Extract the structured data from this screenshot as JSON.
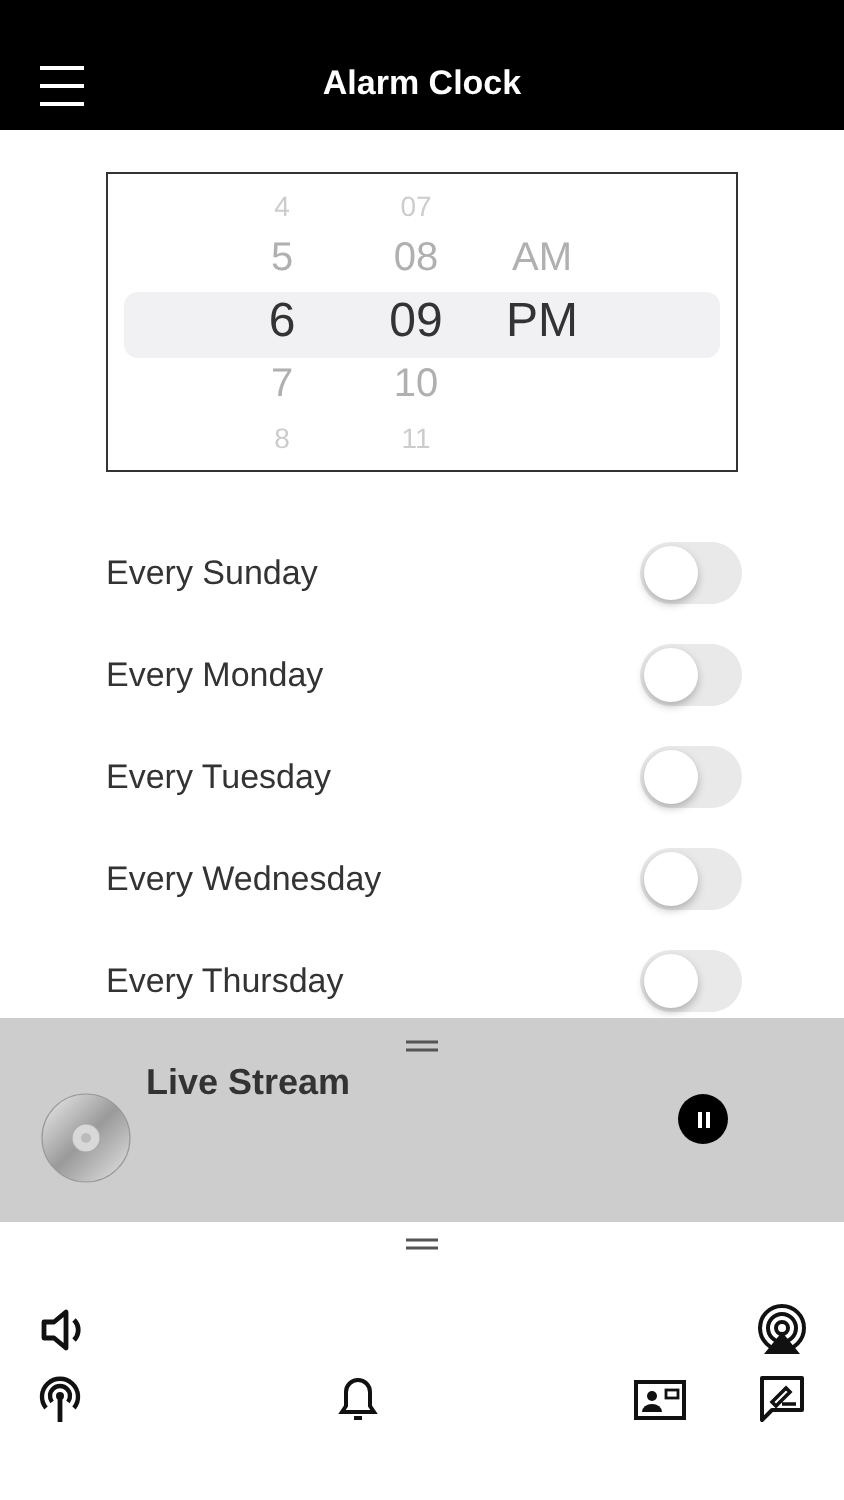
{
  "header": {
    "title": "Alarm Clock"
  },
  "time_picker": {
    "columns": [
      {
        "kind": "hour",
        "items": [
          {
            "text": "4",
            "selected": false
          },
          {
            "text": "5",
            "selected": false
          },
          {
            "text": "6",
            "selected": true
          },
          {
            "text": "7",
            "selected": false
          },
          {
            "text": "8",
            "selected": false
          }
        ]
      },
      {
        "kind": "minute",
        "items": [
          {
            "text": "07",
            "selected": false
          },
          {
            "text": "08",
            "selected": false
          },
          {
            "text": "09",
            "selected": true
          },
          {
            "text": "10",
            "selected": false
          },
          {
            "text": "11",
            "selected": false
          }
        ]
      },
      {
        "kind": "period",
        "items": [
          {
            "text": "AM",
            "selected": false
          },
          {
            "text": "PM",
            "selected": true
          }
        ]
      }
    ]
  },
  "repeat_days": [
    {
      "label": "Every Sunday",
      "on": false
    },
    {
      "label": "Every Monday",
      "on": false
    },
    {
      "label": "Every Tuesday",
      "on": false
    },
    {
      "label": "Every Wednesday",
      "on": false
    },
    {
      "label": "Every Thursday",
      "on": false
    }
  ],
  "player": {
    "title": "Live Stream",
    "playing": true
  }
}
